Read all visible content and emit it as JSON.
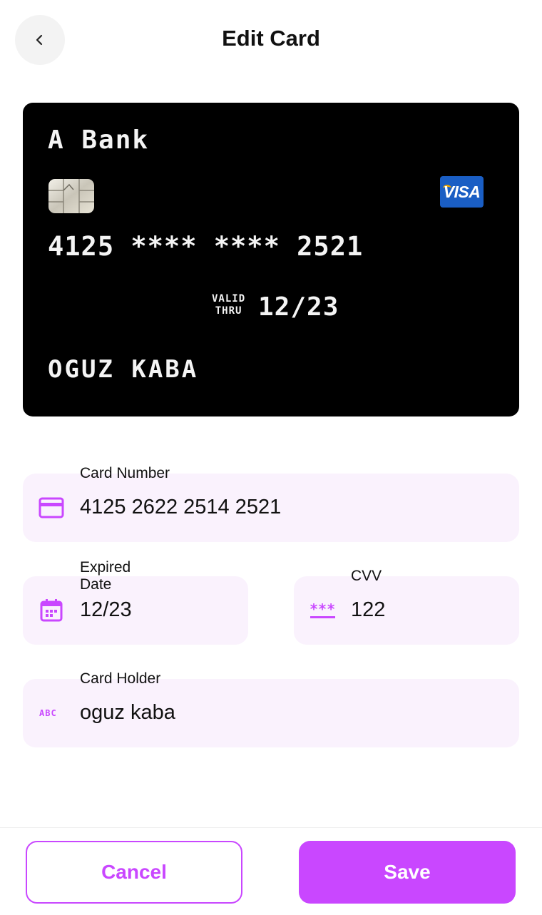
{
  "header": {
    "title": "Edit Card"
  },
  "card_preview": {
    "bank": "A Bank",
    "brand": "VISA",
    "number": "4125 **** **** 2521",
    "valid_thru_line1": "VALID",
    "valid_thru_line2": "THRU",
    "expiry": "12/23",
    "holder": "OGUZ KABA",
    "background_color": "#000000",
    "brand_color": "#1a5ec4"
  },
  "form": {
    "card_number": {
      "label": "Card Number",
      "value": "4125 2622 2514 2521",
      "icon": "credit-card-icon"
    },
    "expiry": {
      "label": "Expired\nDate",
      "value": "12/23",
      "icon": "calendar-icon"
    },
    "cvv": {
      "label": "CVV",
      "value": "122",
      "icon": "password-icon"
    },
    "holder": {
      "label": "Card Holder",
      "value": "oguz kaba",
      "icon": "abc-icon"
    }
  },
  "actions": {
    "cancel": "Cancel",
    "save": "Save"
  },
  "colors": {
    "accent": "#c947ff",
    "field_bg": "#faf2fd"
  }
}
